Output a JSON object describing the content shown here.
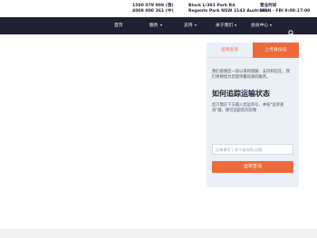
{
  "contact": {
    "phone_1": "1500 079 908 (澳)",
    "phone_2": "4008 000 361 (中)",
    "address_1": "Block L/391 Park Rd",
    "address_2": "Regents Park NSW 2143 Australia",
    "hours_title": "营业时间",
    "hours": "MON - FRI 9:00-17:00"
  },
  "nav": {
    "items": [
      {
        "label": "首页",
        "has_dropdown": false
      },
      {
        "label": "服务",
        "has_dropdown": true
      },
      {
        "label": "支持",
        "has_dropdown": true
      },
      {
        "label": "关于我们",
        "has_dropdown": true
      },
      {
        "label": "会员中心",
        "has_dropdown": true
      }
    ],
    "search_icon": "search-icon"
  },
  "panel": {
    "tabs": [
      {
        "label": "运单查询",
        "active": false
      },
      {
        "label": "上传身份证",
        "active": true
      }
    ],
    "intro": "我们感谢您一直以来的理解、支持和信任，我们将继续为您提供最优质的服务。",
    "heading": "如何追踪运输状态",
    "description": "您只需在下方输入您运单号，并按\"运单查询\"键，便可追踪您的货物",
    "input_placeholder": "运单单号 | 多个查询用,分隔",
    "submit_label": "运单查询"
  },
  "colors": {
    "accent": "#ef6a3a",
    "nav_bg": "#1f2235",
    "panel_bg": "#eaf0f5"
  }
}
